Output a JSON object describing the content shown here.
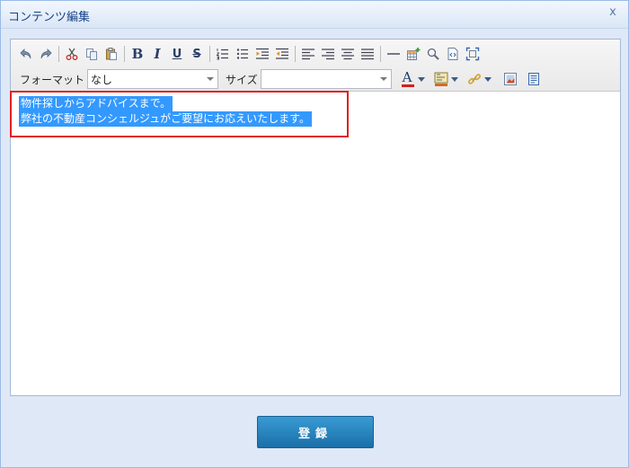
{
  "dialog": {
    "title": "コンテンツ編集",
    "close_glyph": "x"
  },
  "toolbar": {
    "bold": "B",
    "italic": "I",
    "underline": "U",
    "strike": "S",
    "format_label": "フォーマット",
    "format_value": "なし",
    "size_label": "サイズ",
    "size_value": "",
    "font_color_glyph": "A"
  },
  "content": {
    "lines": [
      "物件探しからアドバイスまで。",
      "弊社の不動産コンシェルジュがご要望にお応えいたします。"
    ],
    "selection_color": "#3399ff"
  },
  "footer": {
    "register_label": "登録"
  },
  "colors": {
    "title_text": "#15428b",
    "highlight_border": "#e02020",
    "button": "#1a6fa8"
  }
}
